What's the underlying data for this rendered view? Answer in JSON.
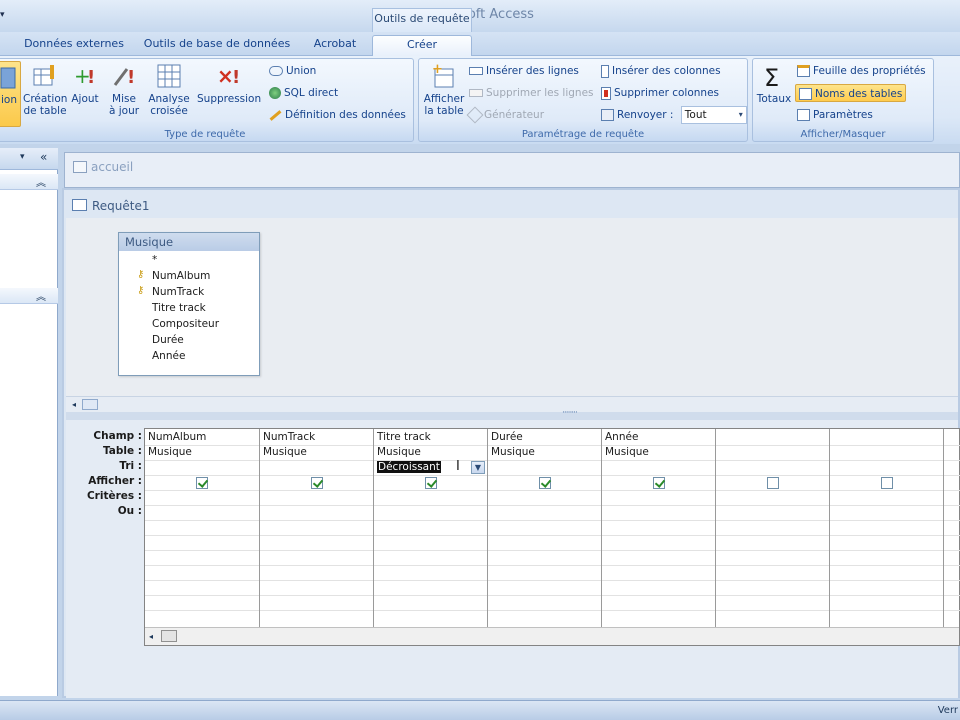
{
  "app_title": "Microsoft Access",
  "context_tab_header": "Outils de requête",
  "tabs": [
    "Données externes",
    "Outils de base de données",
    "Acrobat",
    "Créer"
  ],
  "ribbon": {
    "type_group": {
      "label": "Type de requête",
      "cut_button": "ion",
      "creation_table": [
        "Création",
        "de table"
      ],
      "ajout": "Ajout",
      "mise_a_jour": [
        "Mise",
        "à jour"
      ],
      "analyse_croisee": [
        "Analyse",
        "croisée"
      ],
      "suppression": "Suppression",
      "union": "Union",
      "sql_direct": "SQL direct",
      "definition_donnees": "Définition des données"
    },
    "param_group": {
      "label": "Paramétrage de requête",
      "afficher_table": [
        "Afficher",
        "la table"
      ],
      "inserer_lignes": "Insérer des lignes",
      "supprimer_lignes": "Supprimer les lignes",
      "generateur": "Générateur",
      "inserer_colonnes": "Insérer des colonnes",
      "supprimer_colonnes": "Supprimer colonnes",
      "renvoyer_label": "Renvoyer :",
      "renvoyer_value": "Tout"
    },
    "show_group": {
      "label": "Afficher/Masquer",
      "totaux": "Totaux",
      "feuille_proprietes": "Feuille des propriétés",
      "noms_tables": "Noms des tables",
      "parametres": "Paramètres"
    }
  },
  "accueil_title": "accueil",
  "query_title": "Requête1",
  "table_box": {
    "name": "Musique",
    "fields": [
      "*",
      "NumAlbum",
      "NumTrack",
      "Titre track",
      "Compositeur",
      "Durée",
      "Année"
    ]
  },
  "grid": {
    "row_labels": [
      "Champ :",
      "Table :",
      "Tri :",
      "Afficher :",
      "Critères :",
      "Ou :"
    ],
    "columns": [
      {
        "champ": "NumAlbum",
        "table": "Musique",
        "tri": "",
        "afficher": true
      },
      {
        "champ": "NumTrack",
        "table": "Musique",
        "tri": "",
        "afficher": true
      },
      {
        "champ": "Titre track",
        "table": "Musique",
        "tri": "Décroissant",
        "afficher": true
      },
      {
        "champ": "Durée",
        "table": "Musique",
        "tri": "",
        "afficher": true
      },
      {
        "champ": "Année",
        "table": "Musique",
        "tri": "",
        "afficher": true
      },
      {
        "champ": "",
        "table": "",
        "tri": "",
        "afficher": false
      },
      {
        "champ": "",
        "table": "",
        "tri": "",
        "afficher": false
      }
    ]
  },
  "status_right": "Verr"
}
